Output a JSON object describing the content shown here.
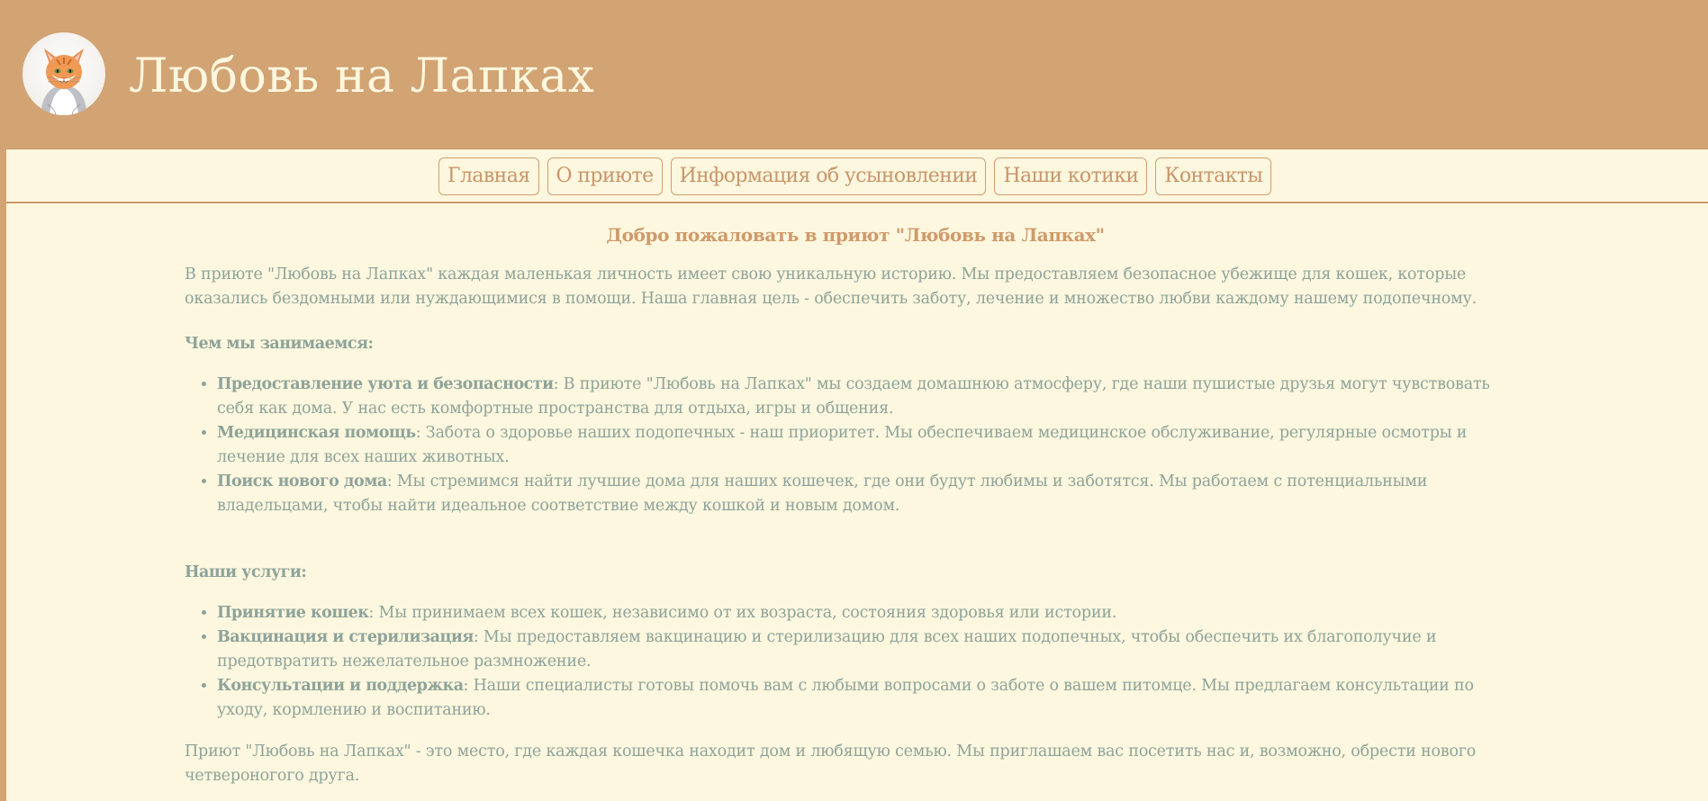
{
  "header": {
    "title": "Любовь на Лапках",
    "logo_icon": "cat-portrait-logo"
  },
  "nav": {
    "items": [
      {
        "label": "Главная"
      },
      {
        "label": "О приюте"
      },
      {
        "label": "Информация об усыновлении"
      },
      {
        "label": "Наши котики"
      },
      {
        "label": "Контакты"
      }
    ]
  },
  "main": {
    "welcome": "Добро пожаловать в приют \"Любовь на Лапках\"",
    "intro": "В приюте \"Любовь на Лапках\" каждая маленькая личность имеет свою уникальную историю. Мы предоставляем безопасное убежище для кошек, которые оказались бездомными или нуждающимися в помощи. Наша главная цель - обеспечить заботу, лечение и множество любви каждому нашему подопечному.",
    "activities_title": "Чем мы занимаемся:",
    "activities": [
      {
        "title": "Предоставление уюта и безопасности",
        "text": ": В приюте \"Любовь на Лапках\" мы создаем домашнюю атмосферу, где наши пушистые друзья могут чувствовать себя как дома. У нас есть комфортные пространства для отдыха, игры и общения."
      },
      {
        "title": "Медицинская помощь",
        "text": ": Забота о здоровье наших подопечных - наш приоритет. Мы обеспечиваем медицинское обслуживание, регулярные осмотры и лечение для всех наших животных."
      },
      {
        "title": "Поиск нового дома",
        "text": ": Мы стремимся найти лучшие дома для наших кошечек, где они будут любимы и заботятся. Мы работаем с потенциальными владельцами, чтобы найти идеальное соответствие между кошкой и новым домом."
      }
    ],
    "services_title": "Наши услуги:",
    "services": [
      {
        "title": "Принятие кошек",
        "text": ": Мы принимаем всех кошек, независимо от их возраста, состояния здоровья или истории."
      },
      {
        "title": "Вакцинация и стерилизация",
        "text": ": Мы предоставляем вакцинацию и стерилизацию для всех наших подопечных, чтобы обеспечить их благополучие и предотвратить нежелательное размножение."
      },
      {
        "title": "Консультации и поддержка",
        "text": ": Наши специалисты готовы помочь вам с любыми вопросами о заботе о вашем питомце. Мы предлагаем консультации по уходу, кормлению и воспитанию."
      }
    ],
    "outro": "Приют \"Любовь на Лапках\" - это место, где каждая кошечка находит дом и любящую семью. Мы приглашаем вас посетить нас и, возможно, обрести нового четвероногого друга."
  },
  "colors": {
    "header_bg": "#d2a373",
    "page_bg": "#fcf7de",
    "accent": "#cf9a6b",
    "text": "#8ea39a"
  }
}
